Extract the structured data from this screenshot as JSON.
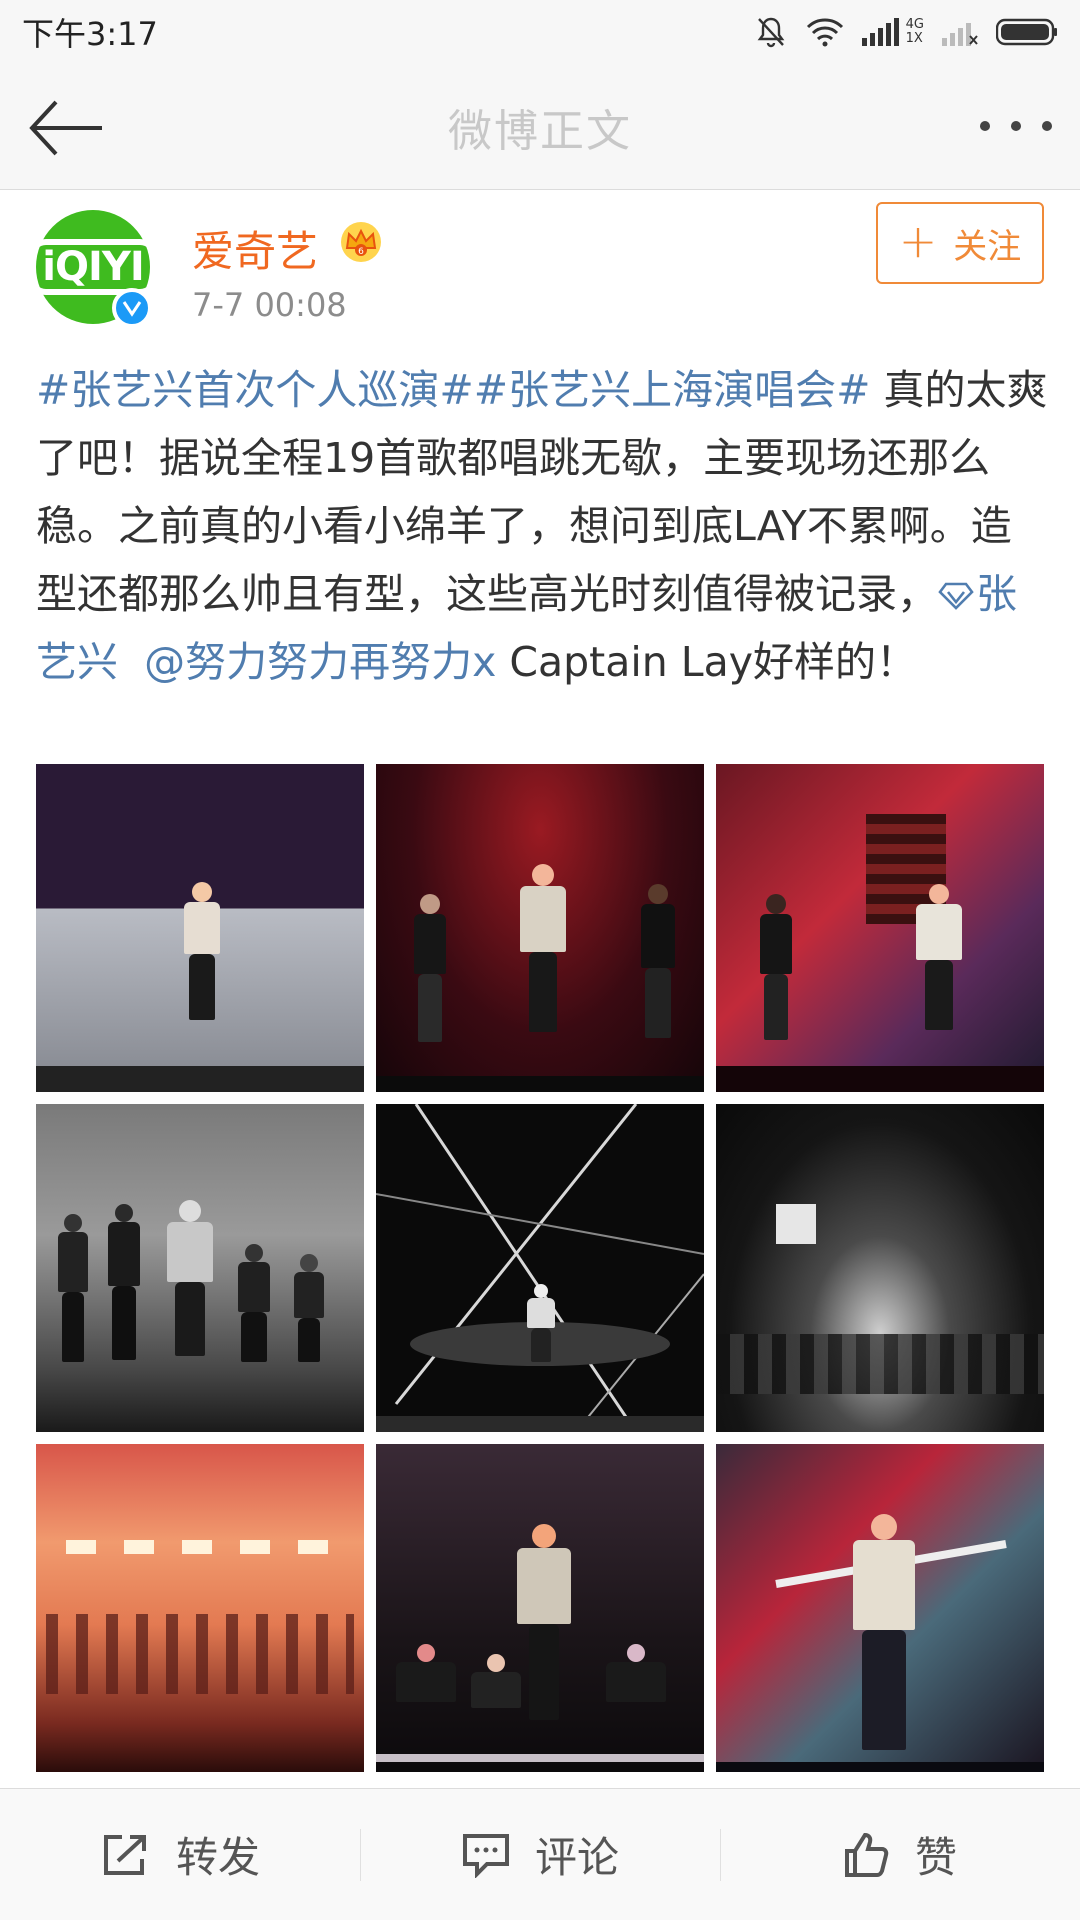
{
  "status_bar": {
    "time": "下午3:17",
    "network_label_top": "4G",
    "network_label_bottom": "1X"
  },
  "nav": {
    "title": "微博正文"
  },
  "post": {
    "user_name": "爱奇艺",
    "avatar_text": "iQIYI",
    "timestamp": "7-7 00:08",
    "follow_label": "关注",
    "text": {
      "topic1": "#张艺兴首次个人巡演#",
      "topic2": "#张艺兴上海演唱会#",
      "body": " 真的太爽了吧！据说全程19首歌都唱跳无歇，主要现场还那么稳。之前真的小看小绵羊了，想问到底LAY不累啊。造型还都那么帅且有型，这些高光时刻值得被记录，",
      "mention1": "张艺兴",
      "mention2": "@努力努力再努力x",
      "tail": " Captain Lay好样的！"
    },
    "images": [
      {
        "scene": "stage-purple"
      },
      {
        "scene": "stage-red-dancers"
      },
      {
        "scene": "stage-red-set"
      },
      {
        "scene": "bw-dancers"
      },
      {
        "scene": "bw-lasers"
      },
      {
        "scene": "bw-wide"
      },
      {
        "scene": "orange-smoke"
      },
      {
        "scene": "dark-dance"
      },
      {
        "scene": "red-pose"
      }
    ]
  },
  "actions": {
    "repost_label": "转发",
    "comment_label": "评论",
    "like_label": "赞"
  },
  "colors": {
    "accent": "#f08a38",
    "username": "#f06820",
    "link": "#507daf",
    "verified": "#1b9af7",
    "avatar_bg": "#3fbb1f"
  },
  "icons": [
    "mute-bell-icon",
    "wifi-icon",
    "signal-icon",
    "battery-icon",
    "back-arrow-icon",
    "more-icon",
    "vip-crown-icon",
    "verified-icon",
    "link-diamond-icon",
    "repost-icon",
    "comment-icon",
    "like-icon"
  ]
}
